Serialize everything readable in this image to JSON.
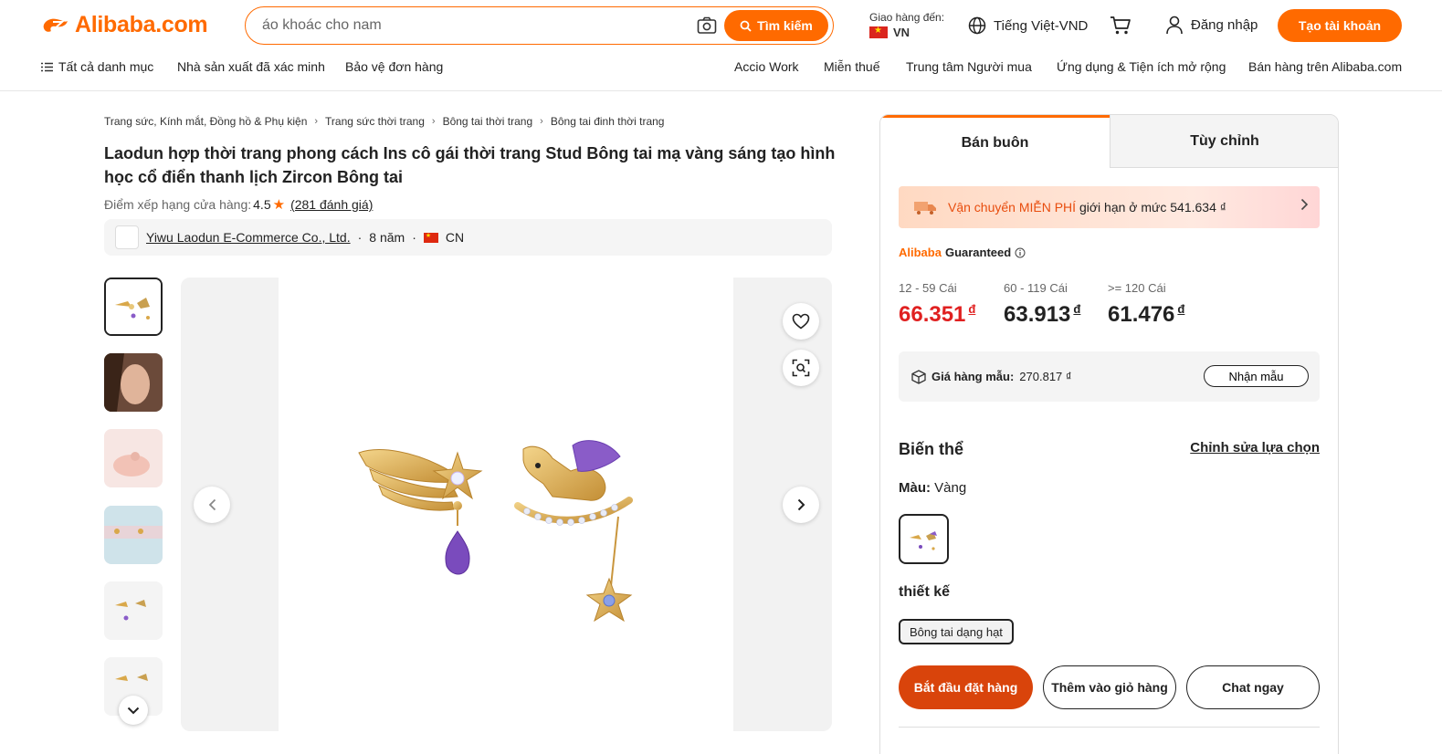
{
  "header": {
    "logo_text": "Alibaba.com",
    "search_placeholder": "áo khoác cho nam",
    "search_button": "Tìm kiếm",
    "deliver_label": "Giao hàng đến:",
    "deliver_country": "VN",
    "language": "Tiếng Việt-VND",
    "login": "Đăng nhập",
    "signup": "Tạo tài khoản"
  },
  "nav": {
    "left": [
      "Tất cả danh mục",
      "Nhà sản xuất đã xác minh",
      "Bảo vệ đơn hàng"
    ],
    "right": [
      "Accio Work",
      "Miễn thuế",
      "Trung tâm Người mua",
      "Ứng dụng & Tiện ích mở rộng",
      "Bán hàng trên Alibaba.com"
    ]
  },
  "breadcrumb": [
    "Trang sức, Kính mắt, Đồng hồ & Phụ kiện",
    "Trang sức thời trang",
    "Bông tai thời trang",
    "Bông tai đinh thời trang"
  ],
  "product": {
    "title": "Laodun hợp thời trang phong cách Ins cô gái thời trang Stud Bông tai mạ vàng sáng tạo hình học cổ điển thanh lịch Zircon Bông tai",
    "rating_label": "Điểm xếp hạng cửa hàng:",
    "rating_value": "4.5",
    "reviews": "(281 đánh giá)",
    "supplier_name": "Yiwu Laodun E-Commerce Co., Ltd.",
    "supplier_years": "8 năm",
    "supplier_country": "CN"
  },
  "panel": {
    "tab_wholesale": "Bán buôn",
    "tab_custom": "Tùy chỉnh",
    "shipping_highlight": "Vận chuyển MIỄN PHÍ",
    "shipping_text": "giới hạn ở mức 541.634 ₫",
    "guarantee_a": "Alibaba",
    "guarantee_b": "Guaranteed",
    "tiers": [
      {
        "qty": "12 - 59 Cái",
        "price": "66.351",
        "currency": "đ"
      },
      {
        "qty": "60 - 119 Cái",
        "price": "63.913",
        "currency": "đ"
      },
      {
        "qty": ">= 120 Cái",
        "price": "61.476",
        "currency": "đ"
      }
    ],
    "sample_label": "Giá hàng mẫu:",
    "sample_price": "270.817 ₫",
    "sample_button": "Nhận mẫu",
    "variants_heading": "Biến thể",
    "edit_selection": "Chỉnh sửa lựa chọn",
    "color_label": "Màu:",
    "color_value": "Vàng",
    "design_label": "thiết kế",
    "design_option": "Bông tai dạng hạt",
    "btn_order": "Bắt đầu đặt hàng",
    "btn_cart": "Thêm vào giỏ hàng",
    "btn_chat": "Chat ngay"
  },
  "colors": {
    "accent": "#ff6a00",
    "price_red": "#e02020",
    "order_btn": "#d9440b"
  }
}
